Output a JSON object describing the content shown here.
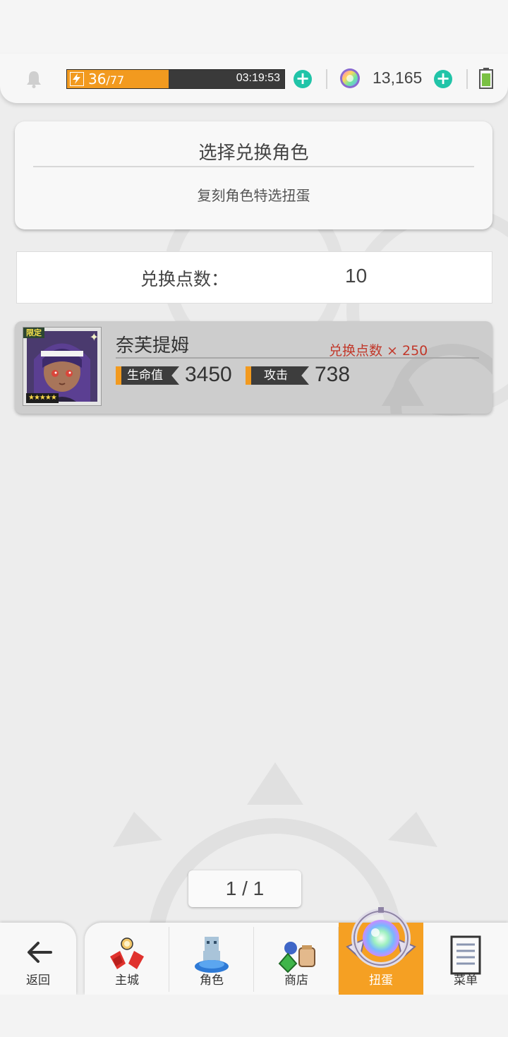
{
  "status_bar": {
    "stamina_current": "36",
    "stamina_separator": "/",
    "stamina_max": "77",
    "stamina_fraction": 0.468,
    "stamina_timer": "03:19:53",
    "gem_count": "13,165"
  },
  "select_panel": {
    "title": "选择兑换角色",
    "subtitle": "复刻角色特选扭蛋"
  },
  "points": {
    "label": "兑换点数：",
    "value": "10"
  },
  "character": {
    "name": "奈芙提姆",
    "cost": "兑换点数 × 250",
    "badge": "限定",
    "stars": "★★★★★",
    "hp_label": "生命值",
    "hp_value": "3450",
    "atk_label": "攻击",
    "atk_value": "738"
  },
  "pager": {
    "text": "1 / 1"
  },
  "nav": {
    "back": "返回",
    "items": [
      "主城",
      "角色",
      "商店",
      "扭蛋",
      "菜单"
    ],
    "active": "扭蛋"
  },
  "colors": {
    "accent": "#f5a023",
    "teal": "#21c4a8",
    "cost_red": "#c1382a",
    "background": "#ededed"
  }
}
